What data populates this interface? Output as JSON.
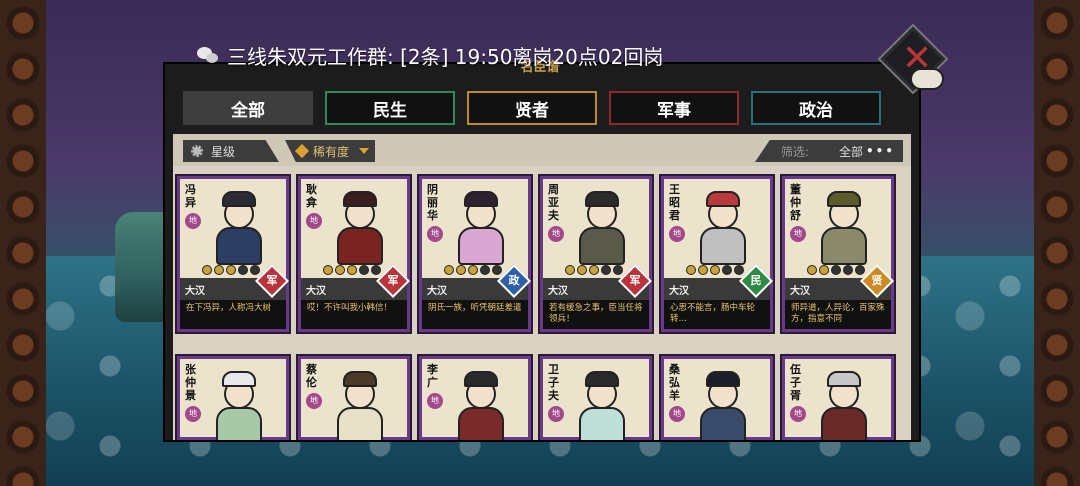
{
  "notification": {
    "text": "三线朱双元工作群: [2条] 19:50离岗20点02回岗",
    "icon": "wechat-icon"
  },
  "panel": {
    "title": "名臣谱"
  },
  "tabs": [
    {
      "label": "全部",
      "active": true
    },
    {
      "label": "民生",
      "active": false
    },
    {
      "label": "贤者",
      "active": false
    },
    {
      "label": "军事",
      "active": false
    },
    {
      "label": "政治",
      "active": false
    }
  ],
  "filters": {
    "star_label": "星级",
    "rarity_label": "稀有度",
    "filter_label": "筛选:",
    "filter_value": "全部",
    "more": "•••"
  },
  "cards_row1": [
    {
      "name": "冯异",
      "grade": "地",
      "faction": "大汉",
      "type": "军",
      "type_color": "#b8333a",
      "stars": 3,
      "quote": "在下冯异，人称冯大树",
      "palette": {
        "hat": "#2b2b36",
        "body": "#2c3e63"
      }
    },
    {
      "name": "耿弇",
      "grade": "地",
      "faction": "大汉",
      "type": "军",
      "type_color": "#b8333a",
      "stars": 3,
      "quote": "哎！不许叫我小韩信！",
      "palette": {
        "hat": "#3a1d1d",
        "body": "#7a2323"
      }
    },
    {
      "name": "阴丽华",
      "grade": "地",
      "faction": "大汉",
      "type": "政",
      "type_color": "#2f5fa8",
      "stars": 3,
      "quote": "阴氏一族，听凭朝廷差遣",
      "palette": {
        "hat": "#2d2030",
        "body": "#d9a7d1"
      }
    },
    {
      "name": "周亚夫",
      "grade": "地",
      "faction": "大汉",
      "type": "军",
      "type_color": "#b8333a",
      "stars": 3,
      "quote": "若有缓急之事，臣当任将领兵！",
      "palette": {
        "hat": "#2b2b2b",
        "body": "#5a5a4a"
      }
    },
    {
      "name": "王昭君",
      "grade": "地",
      "faction": "大汉",
      "type": "民",
      "type_color": "#2e8a45",
      "stars": 3,
      "quote": "心思不能言，肠中车轮转…",
      "palette": {
        "hat": "#b83a3a",
        "body": "#c0c0c0"
      }
    },
    {
      "name": "董仲舒",
      "grade": "地",
      "faction": "大汉",
      "type": "贤",
      "type_color": "#d08a25",
      "stars": 2,
      "quote": "师异道，人异论，百家殊方，指意不同",
      "palette": {
        "hat": "#5a5a2a",
        "body": "#8a8a6a"
      }
    }
  ],
  "cards_row2": [
    {
      "name": "张仲景",
      "grade": "地",
      "palette": {
        "hat": "#e9e9e9",
        "body": "#a8c9a8"
      }
    },
    {
      "name": "蔡伦",
      "grade": "地",
      "palette": {
        "hat": "#4a3a2a",
        "body": "#e6e0c8"
      }
    },
    {
      "name": "李广",
      "grade": "地",
      "palette": {
        "hat": "#2a2a2a",
        "body": "#7a2a2a"
      }
    },
    {
      "name": "卫子夫",
      "grade": "地",
      "palette": {
        "hat": "#2a2a2a",
        "body": "#bfe0d8"
      }
    },
    {
      "name": "桑弘羊",
      "grade": "地",
      "palette": {
        "hat": "#1e1e2a",
        "body": "#3a4a6a"
      }
    },
    {
      "name": "伍子胥",
      "grade": "地",
      "palette": {
        "hat": "#c8c8c8",
        "body": "#6a2a2a"
      }
    }
  ]
}
